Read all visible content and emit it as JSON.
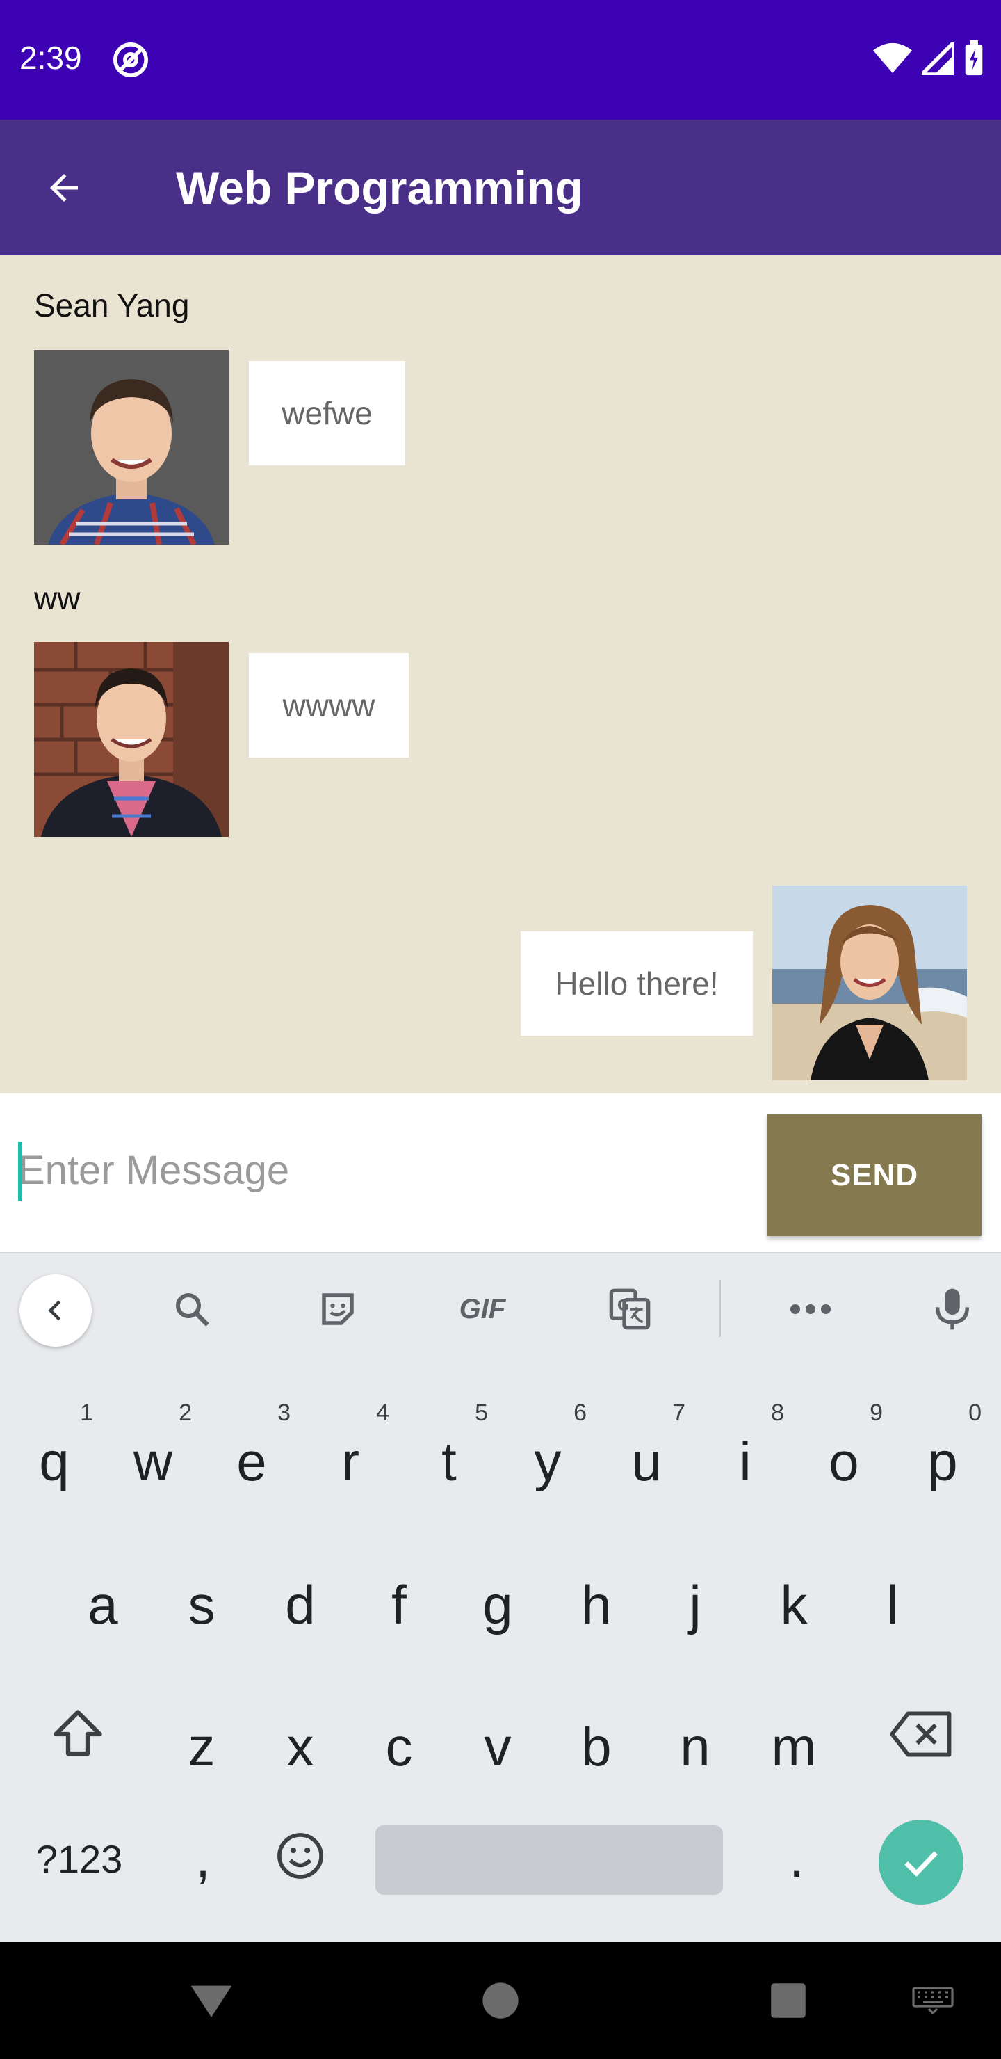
{
  "status": {
    "time": "2:39"
  },
  "appbar": {
    "title": "Web Programming"
  },
  "messages": [
    {
      "sender": "Sean Yang",
      "text": "wefwe",
      "side": "left"
    },
    {
      "sender": "ww",
      "text": "wwww",
      "side": "left"
    },
    {
      "sender": "",
      "text": "Hello there!",
      "side": "right"
    }
  ],
  "composer": {
    "placeholder": "Enter Message",
    "send_label": "SEND"
  },
  "keyboard": {
    "row1": [
      "q",
      "w",
      "e",
      "r",
      "t",
      "y",
      "u",
      "i",
      "o",
      "p"
    ],
    "row1_hints": [
      "1",
      "2",
      "3",
      "4",
      "5",
      "6",
      "7",
      "8",
      "9",
      "0"
    ],
    "row2": [
      "a",
      "s",
      "d",
      "f",
      "g",
      "h",
      "j",
      "k",
      "l"
    ],
    "row3": [
      "z",
      "x",
      "c",
      "v",
      "b",
      "n",
      "m"
    ],
    "symbols_label": "?123",
    "comma": ",",
    "period": ".",
    "gif_label": "GIF"
  },
  "colors": {
    "status_bar": "#3c02b3",
    "app_bar": "#4a2f88",
    "chat_bg": "#e9e3d2",
    "send_button": "#85794f",
    "enter_key": "#4fbfa9"
  }
}
